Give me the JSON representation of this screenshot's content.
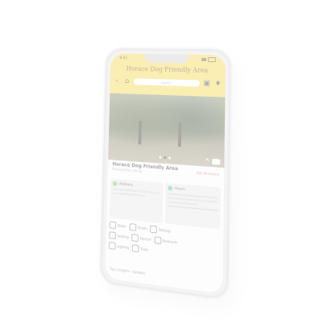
{
  "status_bar": {
    "time": "9:41"
  },
  "header": {
    "title": "Horace Dog Friendly Area",
    "search_placeholder": "Search"
  },
  "place": {
    "name": "Horace Dog Friendly Area",
    "subtitle": "Reviewed by ratings",
    "link": "Get directions"
  },
  "cards": [
    {
      "title": "Address"
    },
    {
      "title": "Hours"
    }
  ],
  "amenities": [
    {
      "label": "Water"
    },
    {
      "label": "Shade"
    },
    {
      "label": "Parking"
    },
    {
      "label": "Seating"
    },
    {
      "label": "Fenced"
    },
    {
      "label": "Restroom"
    },
    {
      "label": "Lighting"
    },
    {
      "label": "Trails"
    }
  ],
  "footer": {
    "text": "Tips, Insights - Updates"
  },
  "colors": {
    "header": "#f6d64a",
    "title": "#6b4a1a"
  }
}
